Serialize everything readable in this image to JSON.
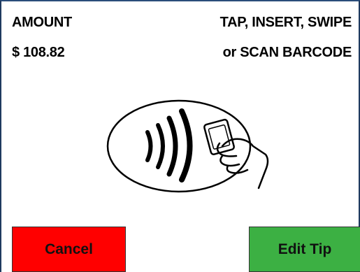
{
  "header": {
    "amount_label": "AMOUNT",
    "amount_value": "$ 108.82",
    "prompt_line1": "TAP, INSERT, SWIPE",
    "prompt_line2": "or SCAN BARCODE"
  },
  "illustration": {
    "icon": "contactless-tap-icon"
  },
  "buttons": {
    "cancel_label": "Cancel",
    "edit_tip_label": "Edit Tip"
  },
  "colors": {
    "cancel_bg": "#ff0000",
    "edit_tip_bg": "#3cb043",
    "frame_border": "#1f3a5f"
  }
}
